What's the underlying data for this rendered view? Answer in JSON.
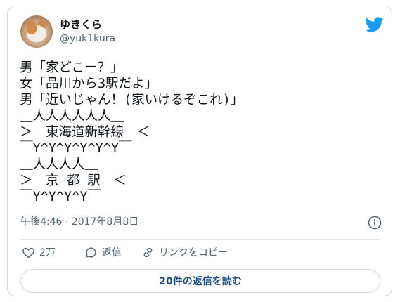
{
  "user": {
    "name": "ゆきくら",
    "handle": "@yuk1kura"
  },
  "tweet": {
    "text": "男「家どこー？」\n女「品川から3駅だよ」\n男「近いじゃん！(家いけるぞこれ)」\n＿人人人人人人＿\n＞　東海道新幹線　＜\n￣Y^Y^Y^Y^Y^Y￣\n＿人人人人＿\n＞　京 都 駅　＜\n￣Y^Y^Y^Y￣"
  },
  "meta": {
    "timestamp": "午後4:46 · 2017年8月8日"
  },
  "actions": {
    "like_count": "2万",
    "reply_label": "返信",
    "share_label": "リンクをコピー"
  },
  "replies_button": "20件の返信を読む",
  "colors": {
    "brand_blue": "#1d9bf0",
    "secondary_text": "#536471",
    "border": "#cfd9de"
  },
  "icons": [
    "twitter-bird-icon",
    "info-icon",
    "heart-icon",
    "reply-bubble-icon",
    "link-icon"
  ]
}
